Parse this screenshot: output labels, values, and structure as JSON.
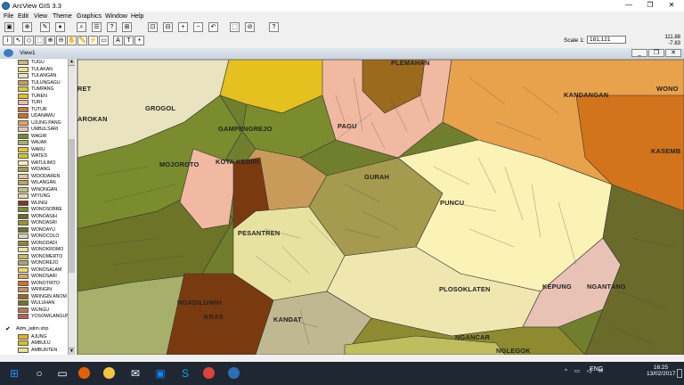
{
  "window": {
    "title": "ArcView GIS 3.3",
    "minimize": "—",
    "restore": "❐",
    "close": "✕"
  },
  "menu": [
    "File",
    "Edit",
    "View",
    "Theme",
    "Graphics",
    "Window",
    "Help"
  ],
  "toolbar": {
    "row1_icons": [
      "save-icon",
      "add-theme-icon",
      "theme-properties-icon",
      "edit-legend-icon",
      "find-icon",
      "locate-address-icon",
      "query-builder-icon",
      "zoom-to-active-icon",
      "zoom-to-selected-icon",
      "zoom-full-icon",
      "zoom-in-icon",
      "zoom-out-icon",
      "zoom-previous-icon",
      "select-features-icon",
      "clear-selection-icon",
      "help-icon"
    ],
    "row2_icons": [
      "info-icon",
      "pointer-icon",
      "vertex-edit-icon",
      "select-feature-icon",
      "zoom-in-tool-icon",
      "zoom-out-tool-icon",
      "pan-icon",
      "measure-icon",
      "hotlink-icon",
      "area-of-interest-icon",
      "label-icon",
      "text-icon",
      "draw-point-icon"
    ],
    "scale_label": "Scale 1:",
    "scale_value": "181,121",
    "coord_x": "111.88",
    "coord_y": "-7.83"
  },
  "view": {
    "title": "View1"
  },
  "legend": {
    "items": [
      {
        "label": "TUGU",
        "color": "#c8b878"
      },
      {
        "label": "TULAKAN",
        "color": "#f2e27a"
      },
      {
        "label": "TULANGAN",
        "color": "#e9e3c0"
      },
      {
        "label": "TULUNGAGU",
        "color": "#c89b5a"
      },
      {
        "label": "TUMPANG",
        "color": "#d7c93d"
      },
      {
        "label": "TUREN",
        "color": "#e4c11e"
      },
      {
        "label": "TURI",
        "color": "#f1b9a1"
      },
      {
        "label": "TUTUR",
        "color": "#c47d45"
      },
      {
        "label": "UDANAWU",
        "color": "#c36f2a"
      },
      {
        "label": "UJUNG PANG",
        "color": "#e8a24c"
      },
      {
        "label": "UMBULSARI",
        "color": "#e8c2b5"
      },
      {
        "label": "WAGIR",
        "color": "#788a2c"
      },
      {
        "label": "WAJAK",
        "color": "#a6b06a"
      },
      {
        "label": "WARU",
        "color": "#e9c22d"
      },
      {
        "label": "WATES",
        "color": "#d3c32a"
      },
      {
        "label": "WATULIMO",
        "color": "#fbf2b5"
      },
      {
        "label": "WIDANG",
        "color": "#a69a4e"
      },
      {
        "label": "WIDODAREN",
        "color": "#d9c58e"
      },
      {
        "label": "WILANGAN",
        "color": "#c0a45a"
      },
      {
        "label": "WINONGAN",
        "color": "#bfc282"
      },
      {
        "label": "WIYUNG",
        "color": "#e8d8a8"
      },
      {
        "label": "WLINGI",
        "color": "#7a3a10"
      },
      {
        "label": "WONOSOBRE",
        "color": "#7b8c2e"
      },
      {
        "label": "WONOASIH",
        "color": "#6a6a2a"
      },
      {
        "label": "WONOASRI",
        "color": "#a2902c"
      },
      {
        "label": "WONOAYU",
        "color": "#6d7428"
      },
      {
        "label": "WONOCOLO",
        "color": "#d8d8b8"
      },
      {
        "label": "WONODADI",
        "color": "#8d8a30"
      },
      {
        "label": "WONOKROMO",
        "color": "#e8e2a0"
      },
      {
        "label": "WONOMERTO",
        "color": "#bfbd5e"
      },
      {
        "label": "WONOREJO",
        "color": "#b7a064"
      },
      {
        "label": "WONOSALAM",
        "color": "#f0d85c"
      },
      {
        "label": "WONOSARI",
        "color": "#dba46a"
      },
      {
        "label": "WONOTIRTO",
        "color": "#d2741c"
      },
      {
        "label": "WRINGIN",
        "color": "#c68f60"
      },
      {
        "label": "WRINGIN ANOM",
        "color": "#9c6a1c"
      },
      {
        "label": "WULUHAN",
        "color": "#6a7a28"
      },
      {
        "label": "WUNGU",
        "color": "#b67b3c"
      },
      {
        "label": "YOSOWILANGUN",
        "color": "#c45a5a"
      }
    ],
    "theme2_name": "Adm_jatim.shp",
    "theme2_items": [
      {
        "label": "AJUNG",
        "color": "#e6b020"
      },
      {
        "label": "AMBULU",
        "color": "#d9c11a"
      },
      {
        "label": "AMBUNTEN",
        "color": "#ebe08a"
      }
    ]
  },
  "map_labels": [
    "RET",
    "GROGOL",
    "PLEMAHAN",
    "KANDANGAN",
    "WONO",
    "AROKAN",
    "GAMPENGREJO",
    "PAGU",
    "KASEMB",
    "MOJOROTO",
    "KOTA KEDIRI",
    "GURAH",
    "PUNCU",
    "PESANTREN",
    "PLOSOKLATEN",
    "KEPUNG",
    "NGANTANG",
    "NGADILUWIH",
    "KRAS",
    "KANDAT",
    "NGANCAR",
    "NGLEGOK"
  ],
  "taskbar": {
    "time": "16:25",
    "date": "13/02/2017",
    "lang": "ENG",
    "apps": [
      "windows-start-icon",
      "search-icon",
      "task-view-icon",
      "firefox-icon",
      "file-explorer-icon",
      "mail-icon",
      "store-icon",
      "skype-icon",
      "chrome-icon",
      "arcview-icon"
    ]
  }
}
